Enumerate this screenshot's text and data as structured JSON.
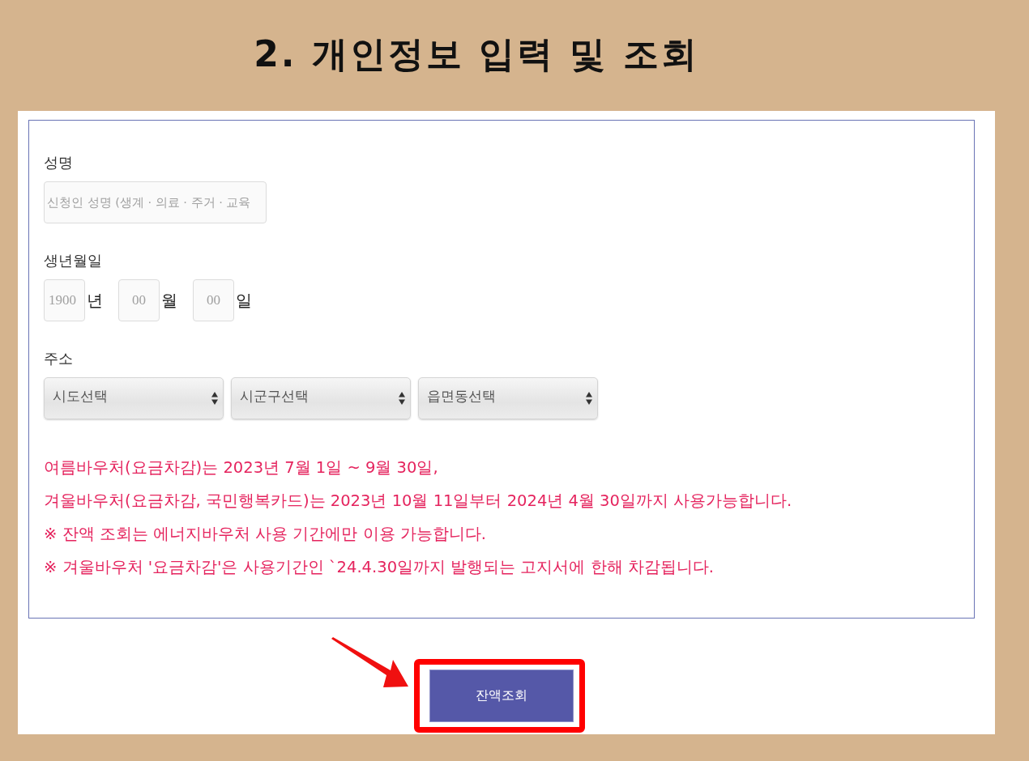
{
  "title": "2. 개인정보 입력 및 조회",
  "form": {
    "name": {
      "label": "성명",
      "placeholder": "신청인 성명 (생계 · 의료 · 주거 · 교육"
    },
    "birth_date": {
      "label": "생년월일",
      "parts": [
        {
          "placeholder": "1900",
          "unit": "년"
        },
        {
          "placeholder": "00",
          "unit": "월"
        },
        {
          "placeholder": "00",
          "unit": "일"
        }
      ]
    },
    "address": {
      "label": "주소",
      "selects": [
        {
          "value": "시도선택"
        },
        {
          "value": "시군구선택"
        },
        {
          "value": "읍면동선택"
        }
      ]
    },
    "notices": [
      "여름바우처(요금차감)는 2023년 7월 1일 ~ 9월 30일,",
      "겨울바우처(요금차감, 국민행복카드)는 2023년 10월 11일부터 2024년 4월 30일까지 사용가능합니다.",
      "※ 잔액 조회는 에너지바우처 사용 기간에만 이용 가능합니다.",
      "※ 겨울바우처 '요금차감'은 사용기간인 `24.4.30일까지 발행되는 고지서에 한해 차감됩니다."
    ]
  },
  "submit_button": {
    "label": "잔액조회",
    "highlighted": true
  }
}
